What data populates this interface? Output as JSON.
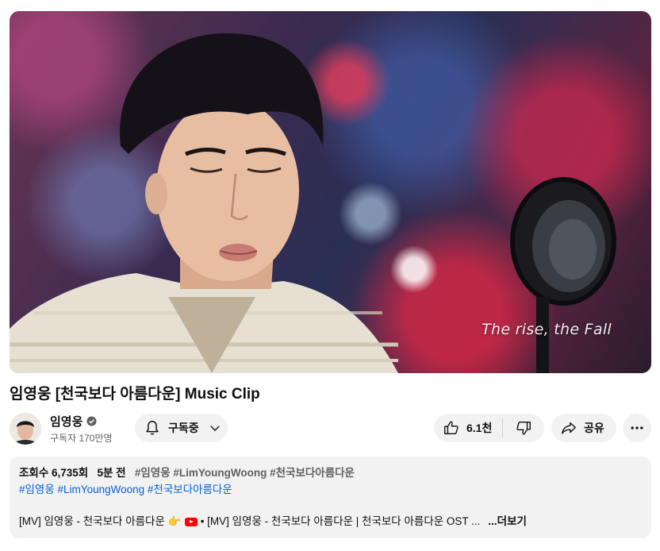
{
  "video": {
    "caption_overlay": "The rise, the Fall",
    "title": "임영웅 [천국보다 아름다운] Music Clip"
  },
  "channel": {
    "name": "임영웅",
    "subscribers": "구독자 170만명"
  },
  "actions": {
    "subscribe_label": "구독중",
    "like_count": "6.1천",
    "share_label": "공유"
  },
  "description": {
    "views": "조회수 6,735회",
    "time_ago": "5분 전",
    "inline_tags": "#임영웅 #LimYoungWoong #천국보다아름다운",
    "tags": [
      "#임영웅",
      "#LimYoungWoong",
      "#천국보다아름다운"
    ],
    "line_start": "[MV] 임영웅 - 천국보다 아름다운",
    "line_emoji": "👉",
    "line_link": "• [MV] 임영웅 - 천국보다 아름다운 | 천국보다 아름다운 OST ...",
    "more_label": "...더보기"
  },
  "colors": {
    "link": "#065fd4",
    "pill_bg": "#f2f2f2",
    "youtube_red": "#ff0000",
    "secondary_text": "#606060"
  },
  "icons": [
    "bell-icon",
    "chevron-down-icon",
    "thumbs-up-icon",
    "thumbs-down-icon",
    "share-icon",
    "more-vert-icon",
    "verified-icon",
    "youtube-logo-icon"
  ]
}
